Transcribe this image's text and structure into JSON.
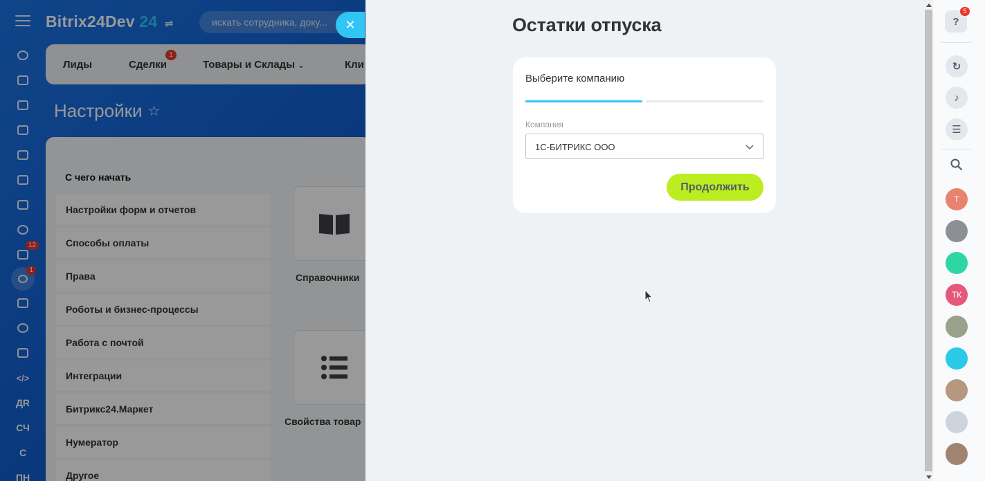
{
  "portal": {
    "logo_text": "Bitrix24Dev",
    "logo_number": "24",
    "search_placeholder": "искать сотрудника, доку...",
    "rail_badges": {
      "tasks": "12",
      "filter": "1"
    },
    "rail_text_items": [
      "ДR",
      "СЧ",
      "С",
      "ПН"
    ],
    "crm_tabs": [
      {
        "label": "Лиды"
      },
      {
        "label": "Сделки",
        "badge": "1"
      },
      {
        "label": "Товары и Склады"
      },
      {
        "label": "Кли"
      }
    ],
    "page_title": "Настройки",
    "section_heading": "С чего начать",
    "menu_items": [
      "Настройки форм и отчетов",
      "Способы оплаты",
      "Права",
      "Роботы и бизнес-процессы",
      "Работа с почтой",
      "Интеграции",
      "Битрикс24.Маркет",
      "Нумератор",
      "Другое"
    ],
    "tiles": [
      {
        "label": "Справочники",
        "icon": "book-icon"
      },
      {
        "label": "Свойства товар",
        "icon": "list-icon"
      }
    ]
  },
  "slider": {
    "title": "Остатки отпуска",
    "step_label": "Выберите компанию",
    "steps_total": 2,
    "current_step": 1,
    "company_field_label": "Компания",
    "company_value": "1С-БИТРИКС ООО",
    "continue_label": "Продолжить"
  },
  "right_rail": {
    "help_badge": "5",
    "avatars": [
      {
        "initials": "Т",
        "color": "#e9826f"
      },
      {
        "initials": "",
        "color": "#8c8f94"
      },
      {
        "initials": "",
        "color": "#2ed6a5"
      },
      {
        "initials": "ТК",
        "color": "#e6587b"
      },
      {
        "initials": "",
        "color": "#9aa08a"
      },
      {
        "initials": "",
        "color": "#29c9e8"
      },
      {
        "initials": "",
        "color": "#b7977f"
      },
      {
        "initials": "",
        "color": "#cdd4dc"
      },
      {
        "initials": "",
        "color": "#a0846f"
      }
    ]
  },
  "colors": {
    "accent": "#2fc6f6",
    "continue_button": "#bbed21",
    "badge": "#e8362b"
  }
}
